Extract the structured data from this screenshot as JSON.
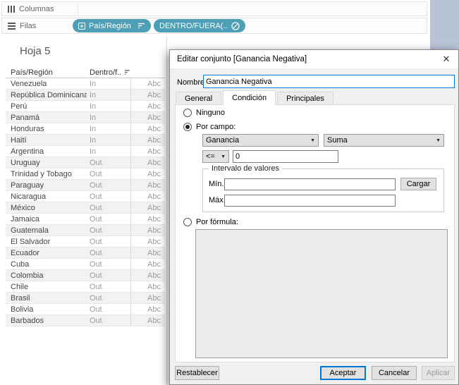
{
  "shelves": {
    "columns": {
      "label": "Columnas"
    },
    "rows": {
      "label": "Filas",
      "pills": [
        {
          "label": "País/Región",
          "icons": [
            "plus-box-icon",
            "sort-descending-icon"
          ]
        },
        {
          "label": "DENTRO/FUERA(..",
          "icons": [
            "set-icon"
          ]
        }
      ]
    }
  },
  "sheet": {
    "title": "Hoja 5",
    "table": {
      "col1_header": "País/Región",
      "col2_header": "Dentro/f..",
      "placeholder": "Abc",
      "rows": [
        {
          "country": "Venezuela",
          "status": "In"
        },
        {
          "country": "República Dominicana",
          "status": "In"
        },
        {
          "country": "Perú",
          "status": "In"
        },
        {
          "country": "Panamá",
          "status": "In"
        },
        {
          "country": "Honduras",
          "status": "In"
        },
        {
          "country": "Haití",
          "status": "In"
        },
        {
          "country": "Argentina",
          "status": "In"
        },
        {
          "country": "Uruguay",
          "status": "Out"
        },
        {
          "country": "Trinidad y Tobago",
          "status": "Out"
        },
        {
          "country": "Paraguay",
          "status": "Out"
        },
        {
          "country": "Nicaragua",
          "status": "Out"
        },
        {
          "country": "México",
          "status": "Out"
        },
        {
          "country": "Jamaica",
          "status": "Out"
        },
        {
          "country": "Guatemala",
          "status": "Out"
        },
        {
          "country": "El Salvador",
          "status": "Out"
        },
        {
          "country": "Ecuador",
          "status": "Out"
        },
        {
          "country": "Cuba",
          "status": "Out"
        },
        {
          "country": "Colombia",
          "status": "Out"
        },
        {
          "country": "Chile",
          "status": "Out"
        },
        {
          "country": "Brasil",
          "status": "Out"
        },
        {
          "country": "Bolivia",
          "status": "Out"
        },
        {
          "country": "Barbados",
          "status": "Out"
        }
      ]
    }
  },
  "dialog": {
    "title": "Editar conjunto [Ganancia Negativa]",
    "close_icon": "✕",
    "name_label": "Nombre:",
    "name_value": "Ganancia Negativa",
    "tabs": [
      "General",
      "Condición",
      "Principales"
    ],
    "active_tab": "Condición",
    "condition": {
      "none_label": "Ninguno",
      "by_field_label": "Por campo:",
      "selected_option": "Por campo:",
      "field_value": "Ganancia",
      "aggregation_value": "Suma",
      "operator_value": "<=",
      "threshold_value": "0",
      "range": {
        "title": "Intervalo de valores",
        "min_label": "Mín.:",
        "min_value": "",
        "max_label": "Máx.:",
        "max_value": "",
        "load_button": "Cargar"
      },
      "by_formula_label": "Por fórmula:",
      "formula_value": ""
    },
    "buttons": {
      "reset": "Restablecer",
      "ok": "Aceptar",
      "cancel": "Cancelar",
      "apply": "Aplicar"
    }
  },
  "colors": {
    "pill": "#4c9fb4",
    "focus_border": "#0078d7",
    "panel_strip": "#b9c3d6",
    "dialog_bg": "#f0f0f0",
    "band": "#f2f2f2"
  },
  "icons": {
    "dropdown_arrow": "▼"
  }
}
